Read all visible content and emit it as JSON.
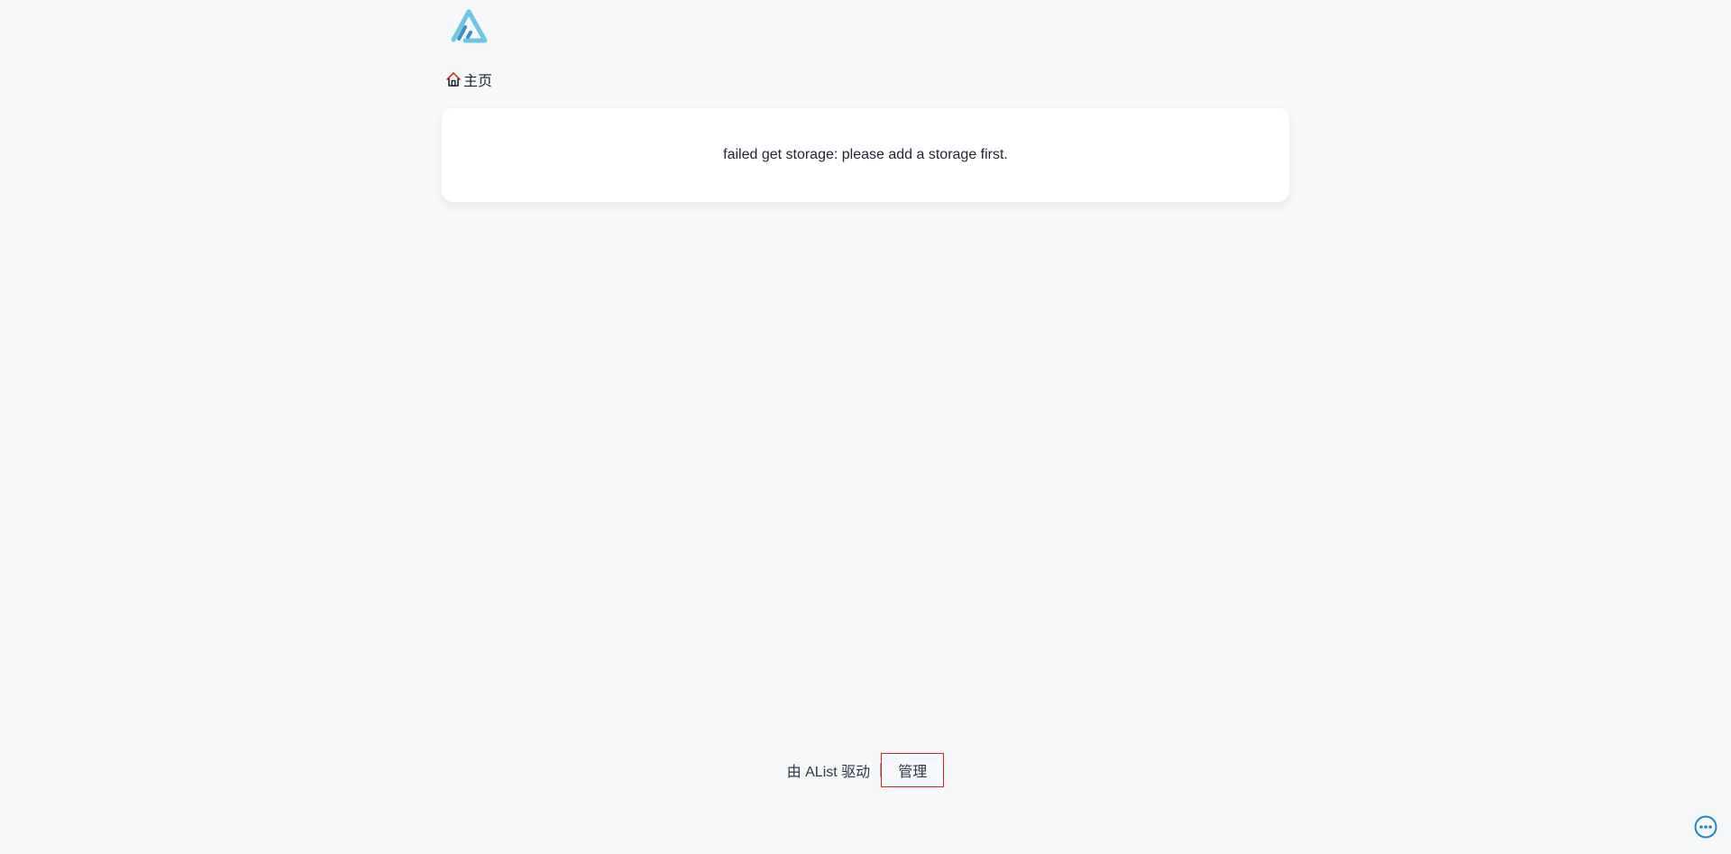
{
  "header": {
    "logo_icon": "alist-logo-icon",
    "logo_colors": [
      "#70c6e2",
      "#3a8fc4"
    ]
  },
  "breadcrumb": {
    "home_icon": "home-icon",
    "home_label": "主页"
  },
  "main": {
    "error_message": "failed get storage: please add a storage first."
  },
  "footer": {
    "powered_by": "由 AList 驱动",
    "separator": "|",
    "manage_label": "管理",
    "highlight_color": "#e11d1d"
  },
  "fab": {
    "icon": "more-horizontal-icon",
    "color": "#1e88c8"
  }
}
